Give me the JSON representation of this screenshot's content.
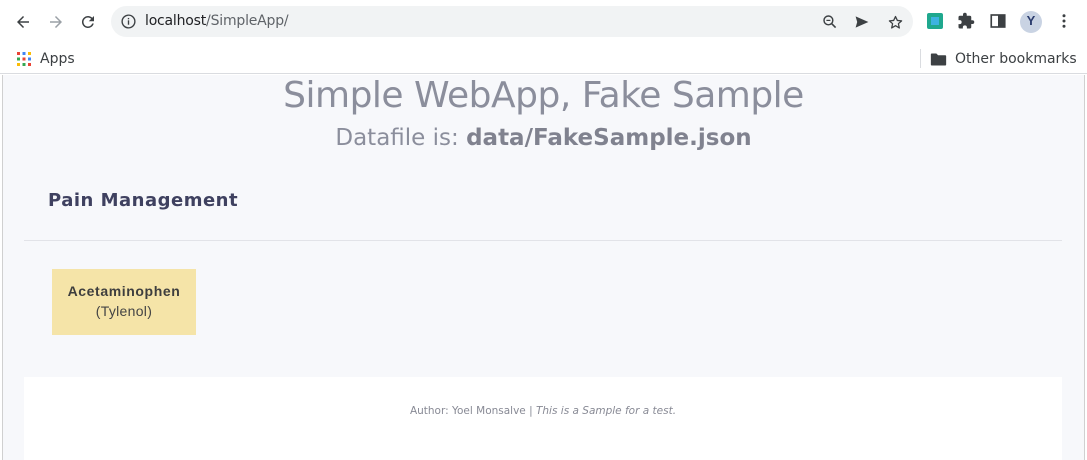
{
  "browser": {
    "url_host": "localhost",
    "url_path": "/SimpleApp/",
    "bookmarks": {
      "apps_label": "Apps",
      "other_label": "Other bookmarks"
    },
    "profile_initial": "Y"
  },
  "page": {
    "title": "Simple WebApp, Fake Sample",
    "subtitle_prefix": "Datafile is: ",
    "datafile": "data/FakeSample.json",
    "section": {
      "title": "Pain Management",
      "cards": [
        {
          "name": "Acetaminophen",
          "brand": "(Tylenol)",
          "color": "#f5e4a8"
        }
      ]
    },
    "footer": {
      "author": "Author: Yoel Monsalve | ",
      "note": "This is a Sample for a test."
    }
  }
}
